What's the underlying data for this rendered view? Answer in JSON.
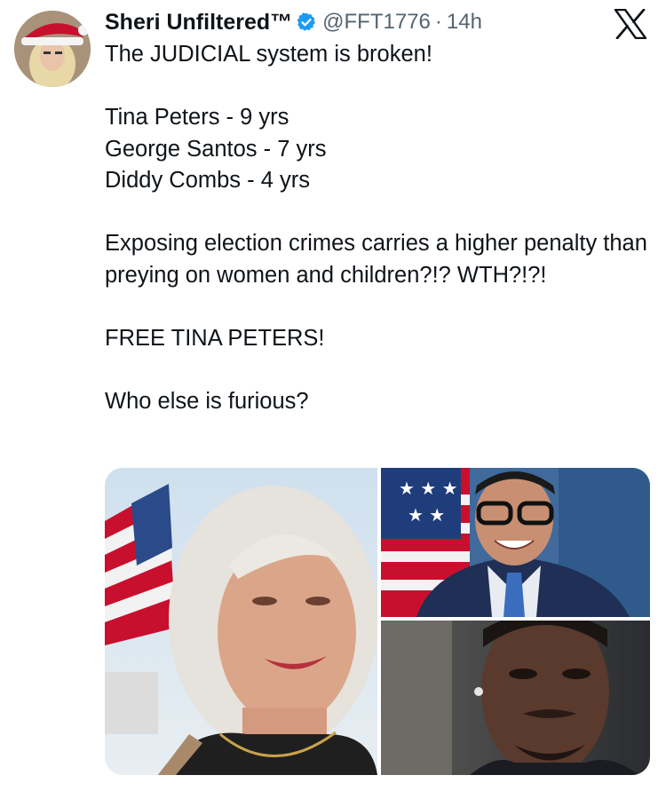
{
  "author": {
    "name": "Sheri Unfiltered",
    "trademark": "™",
    "handle": "@FFT1776",
    "separator": "·",
    "time": "14h",
    "verified_icon": "verified-badge-icon",
    "verified_color": "#1d9bf0"
  },
  "platform_logo": "x-logo-icon",
  "tweet": {
    "lines": [
      "The JUDICIAL system is broken!",
      "",
      "Tina Peters - 9 yrs",
      "George Santos - 7 yrs",
      "Diddy Combs - 4 yrs",
      "",
      "Exposing election crimes carries a higher penalty than preying on women and children?!? WTH?!?!",
      "",
      "FREE TINA PETERS!",
      "",
      "Who else is furious?"
    ]
  },
  "media": {
    "count": 3,
    "items": [
      "woman-with-flag-photo",
      "man-with-glasses-flag-photo",
      "man-portrait-photo"
    ]
  }
}
